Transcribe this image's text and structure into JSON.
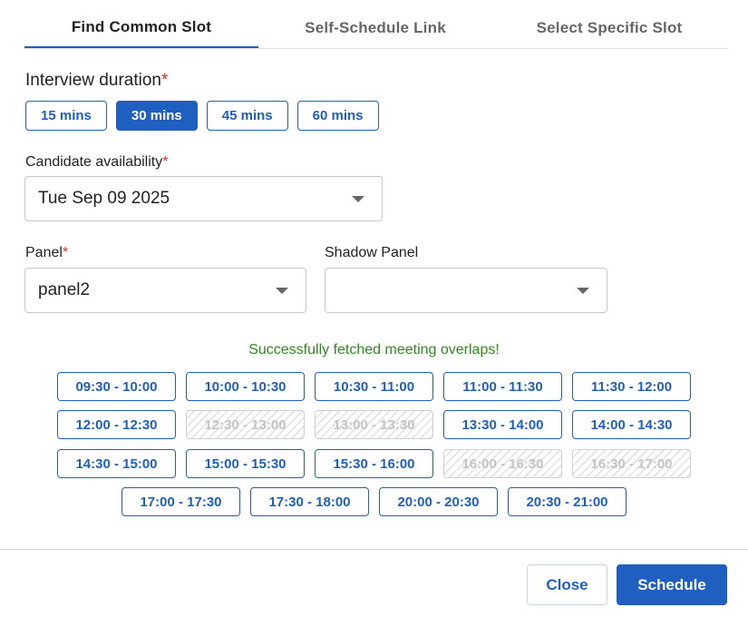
{
  "tabs": [
    "Find Common Slot",
    "Self-Schedule Link",
    "Select Specific Slot"
  ],
  "active_tab": 0,
  "duration": {
    "label": "Interview duration",
    "required_mark": "*",
    "options": [
      "15 mins",
      "30 mins",
      "45 mins",
      "60 mins"
    ],
    "selected": "30 mins"
  },
  "availability": {
    "label": "Candidate availability",
    "required_mark": "*",
    "value": "Tue Sep 09 2025"
  },
  "panel": {
    "label": "Panel",
    "required_mark": "*",
    "value": "panel2"
  },
  "shadow_panel": {
    "label": "Shadow Panel",
    "value": ""
  },
  "status_message": "Successfully fetched meeting overlaps!",
  "slot_rows": [
    [
      {
        "label": "09:30 - 10:00",
        "available": true
      },
      {
        "label": "10:00 - 10:30",
        "available": true
      },
      {
        "label": "10:30 - 11:00",
        "available": true
      },
      {
        "label": "11:00 - 11:30",
        "available": true
      },
      {
        "label": "11:30 - 12:00",
        "available": true
      }
    ],
    [
      {
        "label": "12:00 - 12:30",
        "available": true
      },
      {
        "label": "12:30 - 13:00",
        "available": false
      },
      {
        "label": "13:00 - 13:30",
        "available": false
      },
      {
        "label": "13:30 - 14:00",
        "available": true
      },
      {
        "label": "14:00 - 14:30",
        "available": true
      }
    ],
    [
      {
        "label": "14:30 - 15:00",
        "available": true
      },
      {
        "label": "15:00 - 15:30",
        "available": true
      },
      {
        "label": "15:30 - 16:00",
        "available": true
      },
      {
        "label": "16:00 - 16:30",
        "available": false
      },
      {
        "label": "16:30 - 17:00",
        "available": false
      }
    ],
    [
      {
        "label": "17:00 - 17:30",
        "available": true
      },
      {
        "label": "17:30 - 18:00",
        "available": true
      },
      {
        "label": "20:00 - 20:30",
        "available": true
      },
      {
        "label": "20:30 - 21:00",
        "available": true
      }
    ]
  ],
  "footer": {
    "close_label": "Close",
    "schedule_label": "Schedule"
  },
  "colors": {
    "accent": "#1f5fbf",
    "success": "#2e8b1d",
    "required": "#d93025"
  }
}
